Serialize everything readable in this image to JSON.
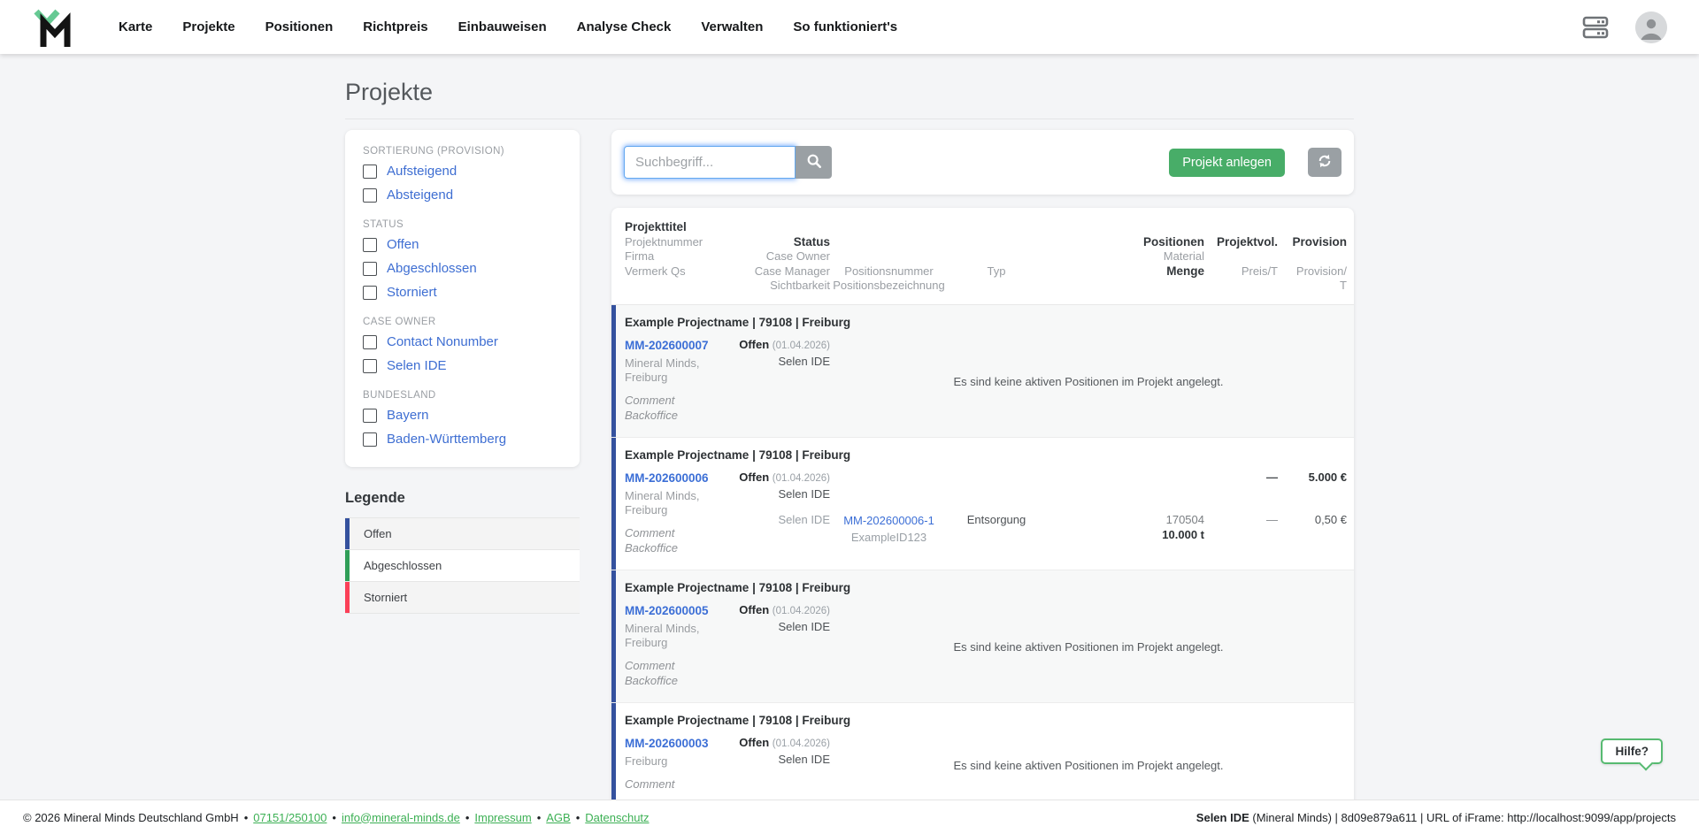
{
  "nav": {
    "items": [
      "Karte",
      "Projekte",
      "Positionen",
      "Richtpreis",
      "Einbauweisen",
      "Analyse Check",
      "Verwalten",
      "So funktioniert's"
    ]
  },
  "icons": {
    "logo": "mineral-minds-logo",
    "topbar": [
      "cards-icon",
      "avatar-icon"
    ],
    "search": "search-icon",
    "refresh": "refresh-icon"
  },
  "page": {
    "title": "Projekte"
  },
  "filters": {
    "sections": [
      {
        "heading": "SORTIERUNG (PROVISION)",
        "options": [
          "Aufsteigend",
          "Absteigend"
        ]
      },
      {
        "heading": "STATUS",
        "options": [
          "Offen",
          "Abgeschlossen",
          "Storniert"
        ]
      },
      {
        "heading": "CASE OWNER",
        "options": [
          "Contact Nonumber",
          "Selen IDE"
        ]
      },
      {
        "heading": "BUNDESLAND",
        "options": [
          "Bayern",
          "Baden-Württemberg"
        ]
      }
    ]
  },
  "legend": {
    "title": "Legende",
    "items": [
      {
        "label": "Offen",
        "color": "#34519e"
      },
      {
        "label": "Abgeschlossen",
        "color": "#2f9e58"
      },
      {
        "label": "Storniert",
        "color": "#fb4058"
      }
    ]
  },
  "toolbar": {
    "search_placeholder": "Suchbegriff...",
    "search_value": "",
    "create_button": "Projekt anlegen",
    "create_button_color": "#48ad68"
  },
  "table": {
    "header_cols": [
      {
        "align": "left",
        "lines": [
          {
            "text": "Projekttitel",
            "bold": true
          },
          {
            "text": "Projektnummer"
          },
          {
            "text": "Firma"
          },
          {
            "text": "Vermerk Qs"
          },
          {
            "text": ""
          }
        ]
      },
      {
        "align": "right",
        "lines": [
          {
            "text": ""
          },
          {
            "text": "Status",
            "bold": true
          },
          {
            "text": "Case Owner"
          },
          {
            "text": "Case Manager"
          },
          {
            "text": "Sichtbarkeit"
          }
        ]
      },
      {
        "align": "center",
        "lines": [
          {
            "text": ""
          },
          {
            "text": ""
          },
          {
            "text": ""
          },
          {
            "text": "Positionsnummer"
          },
          {
            "text": "Positionsbezeichnung"
          }
        ]
      },
      {
        "align": "center",
        "lines": [
          {
            "text": ""
          },
          {
            "text": ""
          },
          {
            "text": ""
          },
          {
            "text": "Typ"
          },
          {
            "text": ""
          }
        ]
      },
      {
        "align": "right",
        "lines": [
          {
            "text": ""
          },
          {
            "text": "Positionen",
            "bold": true
          },
          {
            "text": "Material"
          },
          {
            "text": "Menge",
            "bold": true
          },
          {
            "text": ""
          }
        ]
      },
      {
        "align": "right",
        "lines": [
          {
            "text": ""
          },
          {
            "text": "Projektvol.",
            "bold": true
          },
          {
            "text": ""
          },
          {
            "text": "Preis/T"
          },
          {
            "text": ""
          }
        ]
      },
      {
        "align": "right",
        "lines": [
          {
            "text": ""
          },
          {
            "text": "Provision",
            "bold": true
          },
          {
            "text": ""
          },
          {
            "text": "Provision/"
          },
          {
            "text": "T"
          }
        ]
      }
    ],
    "empty_positions_text": "Es sind keine aktiven Positionen im Projekt angelegt.",
    "rows": [
      {
        "title": "Example Projectname | 79108 | Freiburg",
        "number": "MM-202600007",
        "company": "Mineral Minds,\nFreiburg",
        "notes": "Comment\nBackoffice",
        "status": "Offen",
        "status_date": "(01.04.2026)",
        "case_owner": "Selen IDE",
        "status_color": "#34519e",
        "project_preis": "",
        "project_provision": "",
        "positions": []
      },
      {
        "title": "Example Projectname | 79108 | Freiburg",
        "number": "MM-202600006",
        "company": "Mineral Minds,\nFreiburg",
        "notes": "Comment\nBackoffice",
        "status": "Offen",
        "status_date": "(01.04.2026)",
        "case_owner": "Selen IDE",
        "status_color": "#34519e",
        "project_preis": "—",
        "project_provision": "5.000 €",
        "positions": [
          {
            "case_manager": "Selen IDE",
            "number": "MM-202600006-1",
            "label": "ExampleID123",
            "typ": "Entsorgung",
            "material": "170504",
            "menge": "10.000 t",
            "preis": "—",
            "provision": "0,50 €"
          }
        ]
      },
      {
        "title": "Example Projectname | 79108 | Freiburg",
        "number": "MM-202600005",
        "company": "Mineral Minds,\nFreiburg",
        "notes": "Comment\nBackoffice",
        "status": "Offen",
        "status_date": "(01.04.2026)",
        "case_owner": "Selen IDE",
        "status_color": "#34519e",
        "project_preis": "",
        "project_provision": "",
        "positions": []
      },
      {
        "title": "Example Projectname | 79108 | Freiburg",
        "number": "MM-202600003",
        "company": "Freiburg",
        "notes": "Comment",
        "status": "Offen",
        "status_date": "(01.04.2026)",
        "case_owner": "Selen IDE",
        "status_color": "#34519e",
        "project_preis": "",
        "project_provision": "",
        "positions": []
      }
    ]
  },
  "footer": {
    "copyright": "© 2026 Mineral Minds Deutschland GmbH",
    "separator": "•",
    "links": [
      "07151/250100",
      "info@mineral-minds.de",
      "Impressum",
      "AGB",
      "Datenschutz"
    ],
    "link_color": "#3cb054",
    "session_user": "Selen IDE",
    "session_rest": " (Mineral Minds) | 8d09e879a611 | URL of iFrame: http://localhost:9099/app/projects"
  },
  "help": {
    "label": "Hilfe?"
  }
}
